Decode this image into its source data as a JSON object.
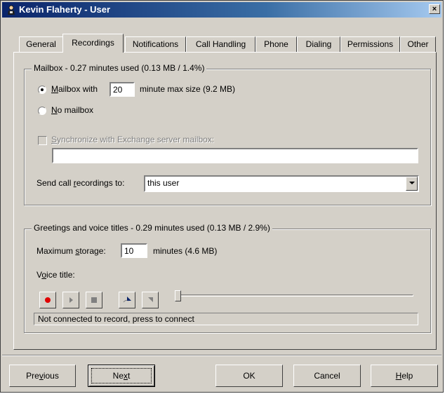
{
  "window": {
    "title": "Kevin Flaherty - User",
    "close_label": "×"
  },
  "tabs": [
    {
      "label": "General"
    },
    {
      "label": "Recordings"
    },
    {
      "label": "Notifications"
    },
    {
      "label": "Call Handling"
    },
    {
      "label": "Phone"
    },
    {
      "label": "Dialing"
    },
    {
      "label": "Permissions"
    },
    {
      "label": "Other"
    }
  ],
  "active_tab": "Recordings",
  "mailbox": {
    "legend": "Mailbox - 0.27 minutes used (0.13 MB / 1.4%)",
    "mailbox_with_pre": "M",
    "mailbox_with_rest": "ailbox with",
    "max_size_value": "20",
    "max_size_suffix": "minute max size (9.2 MB)",
    "no_mailbox_pre": "N",
    "no_mailbox_rest": "o mailbox",
    "selected": "mailbox_with",
    "sync_pre": "S",
    "sync_rest": "ynchronize with Exchange server mailbox:",
    "sync_value": "",
    "send_label_a": "Send call ",
    "send_label_u": "r",
    "send_label_b": "ecordings to:",
    "send_value": "this user"
  },
  "greetings": {
    "legend": "Greetings and voice titles - 0.29 minutes used (0.13 MB / 2.9%)",
    "storage_label_a": "Maximum ",
    "storage_label_u": "s",
    "storage_label_b": "torage:",
    "storage_value": "10",
    "storage_suffix": "minutes (4.6 MB)",
    "voice_title_a": "V",
    "voice_title_u": "o",
    "voice_title_b": "ice title:",
    "status_text": "Not connected to record, press to connect"
  },
  "buttons": {
    "previous_a": "Pre",
    "previous_u": "v",
    "previous_b": "ious",
    "next_a": "Ne",
    "next_u": "x",
    "next_b": "t",
    "ok": "OK",
    "cancel": "Cancel",
    "help_u": "H",
    "help_b": "elp"
  },
  "colors": {
    "record_dot": "#e00000",
    "title_start": "#0a246a"
  }
}
